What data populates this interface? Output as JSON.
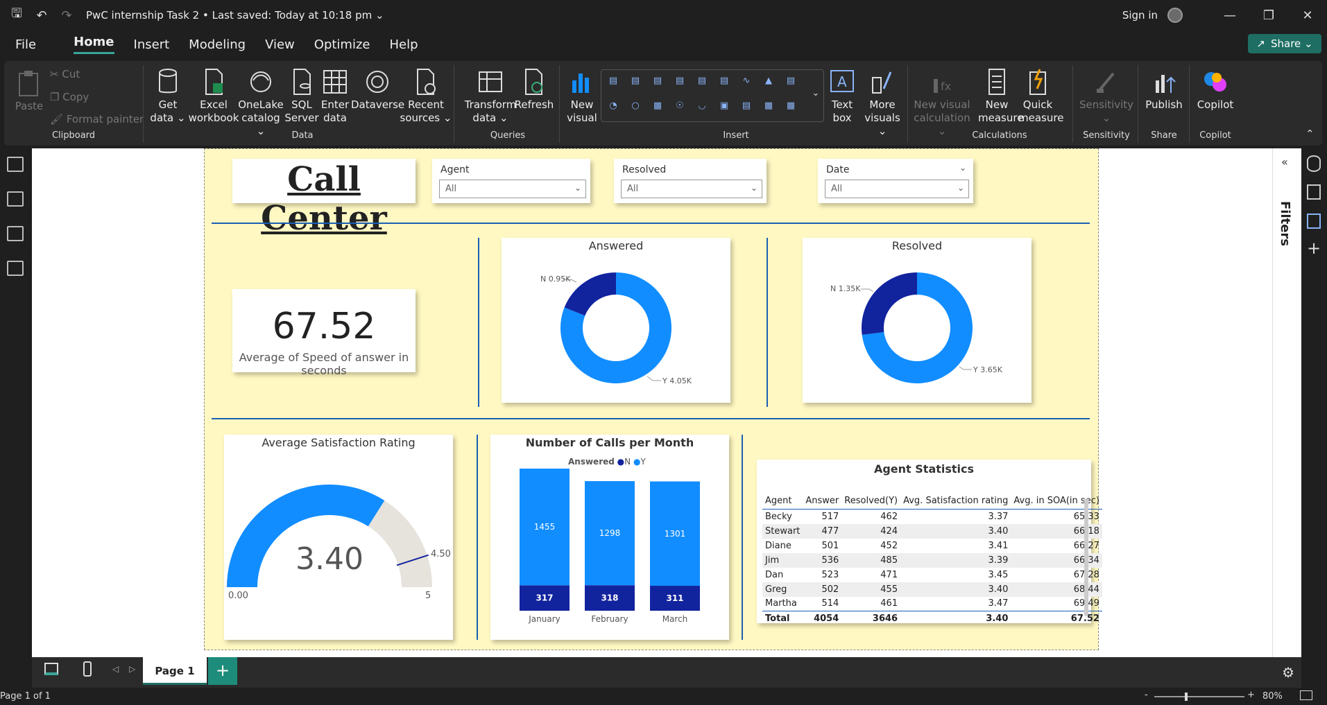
{
  "app": {
    "title": "PwC internship Task 2",
    "saved": "Last saved: Today at 10:18 pm",
    "signin": "Sign in",
    "share": "Share"
  },
  "menu": [
    "File",
    "Home",
    "Insert",
    "Modeling",
    "View",
    "Optimize",
    "Help"
  ],
  "ribbon": {
    "clipboard": {
      "paste": "Paste",
      "cut": "Cut",
      "copy": "Copy",
      "format_painter": "Format painter",
      "label": "Clipboard"
    },
    "data": {
      "get_data": "Get data",
      "excel": "Excel workbook",
      "onelake": "OneLake catalog",
      "sql": "SQL Server",
      "enter": "Enter data",
      "dataverse": "Dataverse",
      "recent": "Recent sources",
      "label": "Data"
    },
    "queries": {
      "transform": "Transform data",
      "refresh": "Refresh",
      "label": "Queries"
    },
    "insert": {
      "new_visual": "New visual",
      "text_box": "Text box",
      "more_visuals": "More visuals",
      "label": "Insert"
    },
    "calculations": {
      "new_visual_calc": "New visual calculation",
      "new_measure": "New measure",
      "quick_measure": "Quick measure",
      "label": "Calculations"
    },
    "sensitivity": {
      "sensitivity": "Sensitivity",
      "label": "Sensitivity"
    },
    "share": {
      "publish": "Publish",
      "label": "Share"
    },
    "copilot": {
      "copilot": "Copilot",
      "label": "Copilot"
    }
  },
  "filters_label": "Filters",
  "report": {
    "title": "Call Center",
    "slicers": [
      {
        "label": "Agent",
        "value": "All"
      },
      {
        "label": "Resolved",
        "value": "All"
      },
      {
        "label": "Date",
        "value": "All"
      }
    ],
    "kpi": {
      "value": "67.52",
      "label": "Average of Speed of answer in seconds"
    },
    "answered": {
      "title": "Answered",
      "n_label": "N 0.95K",
      "y_label": "Y 4.05K",
      "n": 950,
      "y": 4050
    },
    "resolved": {
      "title": "Resolved",
      "n_label": "N 1.35K",
      "y_label": "Y 3.65K",
      "n": 1350,
      "y": 3650
    },
    "gauge": {
      "title": "Average Satisfaction Rating",
      "value": "3.40",
      "min": "0.00",
      "max": "5",
      "target": "4.50",
      "value_num": 3.4,
      "max_num": 5,
      "target_num": 4.5
    },
    "calls": {
      "title": "Number of Calls per Month",
      "legend_title": "Answered",
      "legend_n": "N",
      "legend_y": "Y"
    },
    "table": {
      "title": "Agent Statistics",
      "headers": [
        "Agent",
        "Answer",
        "Resolved(Y)",
        "Avg. Satisfaction rating",
        "Avg. in SOA(in sec)"
      ],
      "rows": [
        [
          "Becky",
          "517",
          "462",
          "3.37",
          "65.33"
        ],
        [
          "Stewart",
          "477",
          "424",
          "3.40",
          "66.18"
        ],
        [
          "Diane",
          "501",
          "452",
          "3.41",
          "66.27"
        ],
        [
          "Jim",
          "536",
          "485",
          "3.39",
          "66.34"
        ],
        [
          "Dan",
          "523",
          "471",
          "3.45",
          "67.28"
        ],
        [
          "Greg",
          "502",
          "455",
          "3.40",
          "68.44"
        ],
        [
          "Martha",
          "514",
          "461",
          "3.47",
          "69.49"
        ]
      ],
      "total": [
        "Total",
        "4054",
        "3646",
        "3.40",
        "67.52"
      ]
    }
  },
  "chart_data": {
    "type": "bar",
    "title": "Number of Calls per Month",
    "categories": [
      "January",
      "February",
      "March"
    ],
    "series": [
      {
        "name": "N",
        "values": [
          317,
          318,
          311
        ]
      },
      {
        "name": "Y",
        "values": [
          1455,
          1298,
          1301
        ]
      }
    ],
    "stacked": true,
    "colors": {
      "N": "#12239e",
      "Y": "#118dff"
    }
  },
  "bottom": {
    "page_tab": "Page 1"
  },
  "status": {
    "page": "Page 1 of 1",
    "zoom": "80%"
  },
  "colors": {
    "dark_blue": "#12239e",
    "light_blue": "#118dff",
    "teal": "#1e6e63",
    "page_bg": "#fff8c2"
  }
}
